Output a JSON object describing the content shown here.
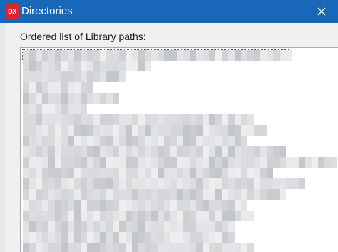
{
  "window": {
    "title": "Directories",
    "app_icon_text": "DX",
    "app_icon_name": "devexpress-logo-icon",
    "close_icon_name": "close-icon",
    "accent_color": "#1967b8"
  },
  "content": {
    "list_label": "Ordered list of Library paths:"
  },
  "library_paths": {
    "note_visibility": "entries are pixelated/obscured in the screenshot",
    "rows": [
      {
        "length": 42
      },
      {
        "length": 20
      },
      {
        "length": 16
      },
      {
        "length": 11
      },
      {
        "length": 15
      },
      {
        "length": 10
      },
      {
        "length": 36
      },
      {
        "length": 38
      },
      {
        "length": 35
      },
      {
        "length": 41
      },
      {
        "length": 49
      },
      {
        "length": 39
      },
      {
        "length": 44
      },
      {
        "length": 41
      },
      {
        "length": 35
      },
      {
        "length": 36
      },
      {
        "length": 33
      },
      {
        "length": 33
      },
      {
        "length": 36
      }
    ]
  }
}
